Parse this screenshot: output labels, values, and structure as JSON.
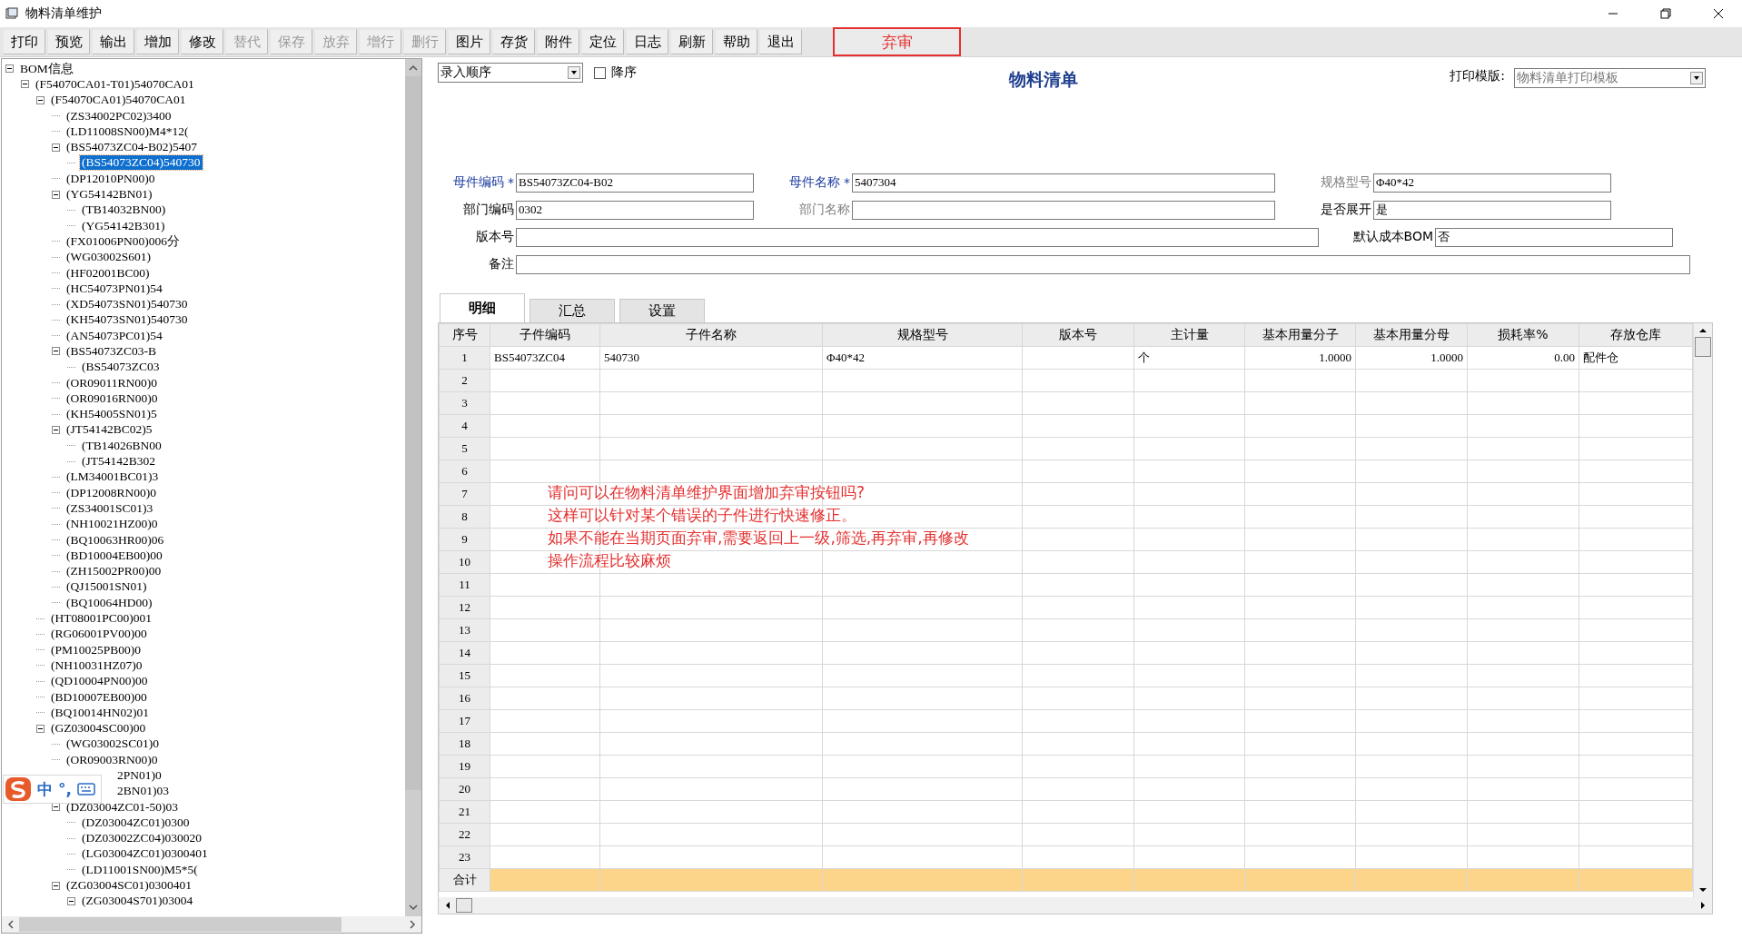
{
  "window": {
    "title": "物料清单维护"
  },
  "toolbar": [
    {
      "label": "打印",
      "disabled": false
    },
    {
      "label": "预览",
      "disabled": false
    },
    {
      "label": "输出",
      "disabled": false
    },
    {
      "label": "增加",
      "disabled": false
    },
    {
      "label": "修改",
      "disabled": false
    },
    {
      "label": "替代",
      "disabled": true
    },
    {
      "label": "保存",
      "disabled": true
    },
    {
      "label": "放弃",
      "disabled": true
    },
    {
      "label": "增行",
      "disabled": true
    },
    {
      "label": "删行",
      "disabled": true
    },
    {
      "label": "图片",
      "disabled": false
    },
    {
      "label": "存货",
      "disabled": false
    },
    {
      "label": "附件",
      "disabled": false
    },
    {
      "label": "定位",
      "disabled": false
    },
    {
      "label": "日志",
      "disabled": false
    },
    {
      "label": "刷新",
      "disabled": false
    },
    {
      "label": "帮助",
      "disabled": false
    },
    {
      "label": "退出",
      "disabled": false
    }
  ],
  "highlighted_button": {
    "label": "弃审"
  },
  "tree": [
    {
      "label": "BOM信息",
      "selected": false,
      "expanded": true,
      "children": [
        {
          "label": "(F54070CA01-T01)54070CA01",
          "selected": false,
          "expanded": true,
          "children": [
            {
              "label": "(F54070CA01)54070CA01",
              "selected": false,
              "expanded": true,
              "children": [
                {
                  "label": "(ZS34002PC02)3400",
                  "selected": false
                },
                {
                  "label": "(LD11008SN00)M4*12(",
                  "selected": false
                },
                {
                  "label": "(BS54073ZC04-B02)5407",
                  "selected": false,
                  "expanded": true,
                  "children": [
                    {
                      "label": "(BS54073ZC04)540730",
                      "selected": true
                    }
                  ]
                },
                {
                  "label": "(DP12010PN00)0",
                  "selected": false
                },
                {
                  "label": "(YG54142BN01)",
                  "selected": false,
                  "expanded": true,
                  "children": [
                    {
                      "label": "(TB14032BN00)",
                      "selected": false
                    },
                    {
                      "label": "(YG54142B301)",
                      "selected": false
                    }
                  ]
                },
                {
                  "label": "(FX01006PN00)006分",
                  "selected": false
                },
                {
                  "label": "(WG03002S601)",
                  "selected": false
                },
                {
                  "label": "(HF02001BC00)",
                  "selected": false
                },
                {
                  "label": "(HC54073PN01)54",
                  "selected": false
                },
                {
                  "label": "(XD54073SN01)540730",
                  "selected": false
                },
                {
                  "label": "(KH54073SN01)540730",
                  "selected": false
                },
                {
                  "label": "(AN54073PC01)54",
                  "selected": false
                },
                {
                  "label": "(BS54073ZC03-B",
                  "selected": false,
                  "expanded": true,
                  "children": [
                    {
                      "label": "(BS54073ZC03",
                      "selected": false
                    }
                  ]
                },
                {
                  "label": "(OR09011RN00)0",
                  "selected": false
                },
                {
                  "label": "(OR09016RN00)0",
                  "selected": false
                },
                {
                  "label": "(KH54005SN01)5",
                  "selected": false
                },
                {
                  "label": "(JT54142BC02)5",
                  "selected": false,
                  "expanded": true,
                  "children": [
                    {
                      "label": "(TB14026BN00",
                      "selected": false
                    },
                    {
                      "label": "(JT54142B302",
                      "selected": false
                    }
                  ]
                },
                {
                  "label": "(LM34001BC01)3",
                  "selected": false
                },
                {
                  "label": "(DP12008RN00)0",
                  "selected": false
                },
                {
                  "label": "(ZS34001SC01)3",
                  "selected": false
                },
                {
                  "label": "(NH10021HZ00)0",
                  "selected": false
                },
                {
                  "label": "(BQ10063HR00)06",
                  "selected": false
                },
                {
                  "label": "(BD10004EB00)00",
                  "selected": false
                },
                {
                  "label": "(ZH15002PR00)00",
                  "selected": false
                },
                {
                  "label": "(QJ15001SN01)",
                  "selected": false
                },
                {
                  "label": "(BQ10064HD00)",
                  "selected": false
                }
              ]
            },
            {
              "label": "(HT08001PC00)001",
              "selected": false
            },
            {
              "label": "(RG06001PV00)00",
              "selected": false
            },
            {
              "label": "(PM10025PB00)0",
              "selected": false
            },
            {
              "label": "(NH10031HZ07)0",
              "selected": false
            },
            {
              "label": "(QD10004PN00)00",
              "selected": false
            },
            {
              "label": "(BD10007EB00)00",
              "selected": false
            },
            {
              "label": "(BQ10014HN02)01",
              "selected": false
            },
            {
              "label": "(GZ03004SC00)00",
              "selected": false,
              "expanded": true,
              "children": [
                {
                  "label": "(WG03002SC01)0",
                  "selected": false
                },
                {
                  "label": "(OR09003RN00)0",
                  "selected": false
                },
                {
                  "label": "2PN01)0",
                  "selected": false,
                  "obscured": true
                },
                {
                  "label": "2BN01)03",
                  "selected": false,
                  "obscured": true
                },
                {
                  "label": "(DZ03004ZC01-50)03",
                  "selected": false,
                  "expanded": true,
                  "children": [
                    {
                      "label": "(DZ03004ZC01)0300",
                      "selected": false
                    },
                    {
                      "label": "(DZ03002ZC04)030020",
                      "selected": false
                    },
                    {
                      "label": "(LG03004ZC01)0300401",
                      "selected": false
                    },
                    {
                      "label": "(LD11001SN00)M5*5(",
                      "selected": false
                    }
                  ]
                },
                {
                  "label": "(ZG03004SC01)0300401",
                  "selected": false,
                  "expanded": true,
                  "children": [
                    {
                      "label": "(ZG03004S701)03004",
                      "selected": false,
                      "expanded": true
                    }
                  ]
                }
              ]
            }
          ]
        }
      ]
    }
  ],
  "ime_bar": {
    "mode": "中",
    "punct": "°,"
  },
  "sort": {
    "value": "录入顺序",
    "descending_label": "降序",
    "descending": false
  },
  "heading": "物料清单",
  "print_template": {
    "label": "打印模版:",
    "value": "物料清单打印模板"
  },
  "form": [
    [
      {
        "label": "母件编码",
        "kind": "required",
        "mark": "*",
        "value": "BS54073ZC04-B02"
      },
      {
        "label": "母件名称",
        "kind": "required",
        "mark": "*",
        "value": "5407304"
      },
      {
        "label": "规格型号",
        "kind": "readonly",
        "value": "Φ40*42"
      }
    ],
    [
      {
        "label": "部门编码",
        "kind": "normal",
        "value": "0302"
      },
      {
        "label": "部门名称",
        "kind": "readonly"
      },
      {
        "label": "是否展开",
        "kind": "normal",
        "value": "是"
      }
    ],
    [
      {
        "label": "版本号",
        "kind": "normal"
      },
      {
        "label": "默认成本BOM",
        "kind": "normal",
        "value": "否"
      }
    ],
    [
      {
        "label": "备注",
        "kind": "normal"
      }
    ]
  ],
  "tabs": [
    {
      "label": "明细",
      "selected": true
    },
    {
      "label": "汇总",
      "selected": false
    },
    {
      "label": "设置",
      "selected": false
    }
  ],
  "table": {
    "columns": [
      "序号",
      "子件编码",
      "子件名称",
      "规格型号",
      "版本号",
      "主计量",
      "基本用量分子",
      "基本用量分母",
      "损耗率%",
      "存放仓库"
    ],
    "rows": [
      {
        "no": "1",
        "part_code": "BS54073ZC04",
        "part_name": "540730",
        "spec": "Φ40*42",
        "unit": "个",
        "qty_num": "1.0000",
        "qty_den": "1.0000",
        "loss_rate": "0.00",
        "warehouse": "配件仓"
      },
      {
        "no": "2"
      },
      {
        "no": "3"
      },
      {
        "no": "4"
      },
      {
        "no": "5"
      },
      {
        "no": "6"
      },
      {
        "no": "7"
      },
      {
        "no": "8"
      },
      {
        "no": "9"
      },
      {
        "no": "10"
      },
      {
        "no": "11"
      },
      {
        "no": "12"
      },
      {
        "no": "13"
      },
      {
        "no": "14"
      },
      {
        "no": "15"
      },
      {
        "no": "16"
      },
      {
        "no": "17"
      },
      {
        "no": "18"
      },
      {
        "no": "19"
      },
      {
        "no": "20"
      },
      {
        "no": "21"
      },
      {
        "no": "22"
      },
      {
        "no": "23"
      }
    ],
    "total_label": "合计"
  },
  "annotation": [
    "请问可以在物料清单维护界面增加弃审按钮吗?",
    "这样可以针对某个错误的子件进行快速修正。",
    "如果不能在当期页面弃审,需要返回上一级,筛选,再弃审,再修改",
    "操作流程比较麻烦"
  ]
}
